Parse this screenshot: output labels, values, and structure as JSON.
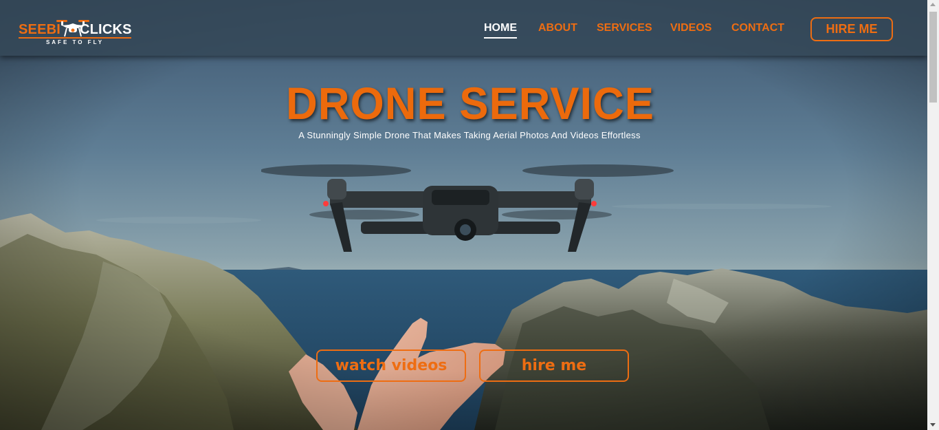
{
  "brand": {
    "name_left": "SEEBI",
    "name_right": "CLICKS",
    "tagline": "SAFE TO FLY",
    "accent_color": "#ee6d12",
    "icon": "drone-icon"
  },
  "nav": {
    "items": [
      {
        "label": "HOME",
        "active": true
      },
      {
        "label": "ABOUT",
        "active": false
      },
      {
        "label": "SERVICES",
        "active": false
      },
      {
        "label": "VIDEOS",
        "active": false
      },
      {
        "label": "CONTACT",
        "active": false
      }
    ],
    "hire_button": "HIRE ME"
  },
  "hero": {
    "title": "DRONE SERVICE",
    "subtitle": "A Stunningly Simple Drone That Makes Taking Aerial Photos And Videos Effortless",
    "buttons": {
      "watch": "watch videos",
      "hire": "hire me"
    },
    "background": "drone-over-coastal-cliffs-photo"
  },
  "colors": {
    "accent": "#ee6d12",
    "navbar": "#344858",
    "text_light": "#ffffff"
  }
}
